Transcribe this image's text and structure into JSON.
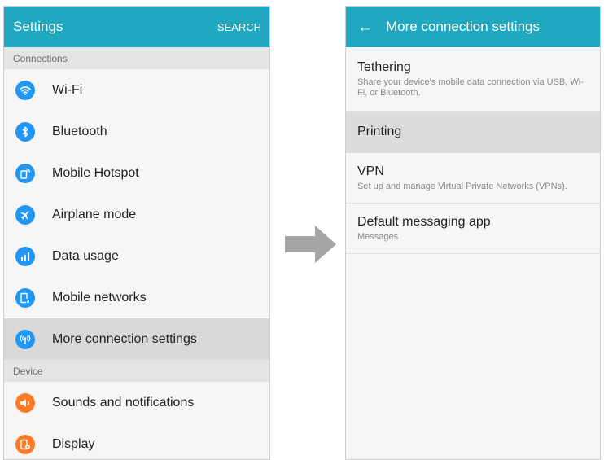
{
  "colors": {
    "appbar": "#1fa8c0",
    "connections_icons": "#2196f3",
    "device_icons": "#ff7a26",
    "selected_row": "#d9d9d9",
    "arrow": "#a6a6a6"
  },
  "left_screen": {
    "title": "Settings",
    "search_label": "SEARCH",
    "sections": [
      {
        "header": "Connections",
        "items": [
          {
            "label": "Wi-Fi",
            "icon": "wifi-icon"
          },
          {
            "label": "Bluetooth",
            "icon": "bluetooth-icon"
          },
          {
            "label": "Mobile Hotspot",
            "icon": "hotspot-icon"
          },
          {
            "label": "Airplane mode",
            "icon": "airplane-icon"
          },
          {
            "label": "Data usage",
            "icon": "data-usage-icon"
          },
          {
            "label": "Mobile networks",
            "icon": "mobile-networks-icon"
          },
          {
            "label": "More connection settings",
            "icon": "antenna-icon",
            "selected": true
          }
        ]
      },
      {
        "header": "Device",
        "items": [
          {
            "label": "Sounds and notifications",
            "icon": "speaker-icon"
          },
          {
            "label": "Display",
            "icon": "display-icon"
          }
        ]
      }
    ]
  },
  "transition_icon": "arrow-right-icon",
  "right_screen": {
    "title": "More connection settings",
    "back_icon": "back-arrow-icon",
    "items": [
      {
        "title": "Tethering",
        "subtitle": "Share your device's mobile data connection via USB, Wi-Fi, or Bluetooth."
      },
      {
        "title": "Printing",
        "selected": true
      },
      {
        "title": "VPN",
        "subtitle": "Set up and manage Virtual Private Networks (VPNs)."
      },
      {
        "title": "Default messaging app",
        "subtitle": "Messages"
      }
    ]
  }
}
